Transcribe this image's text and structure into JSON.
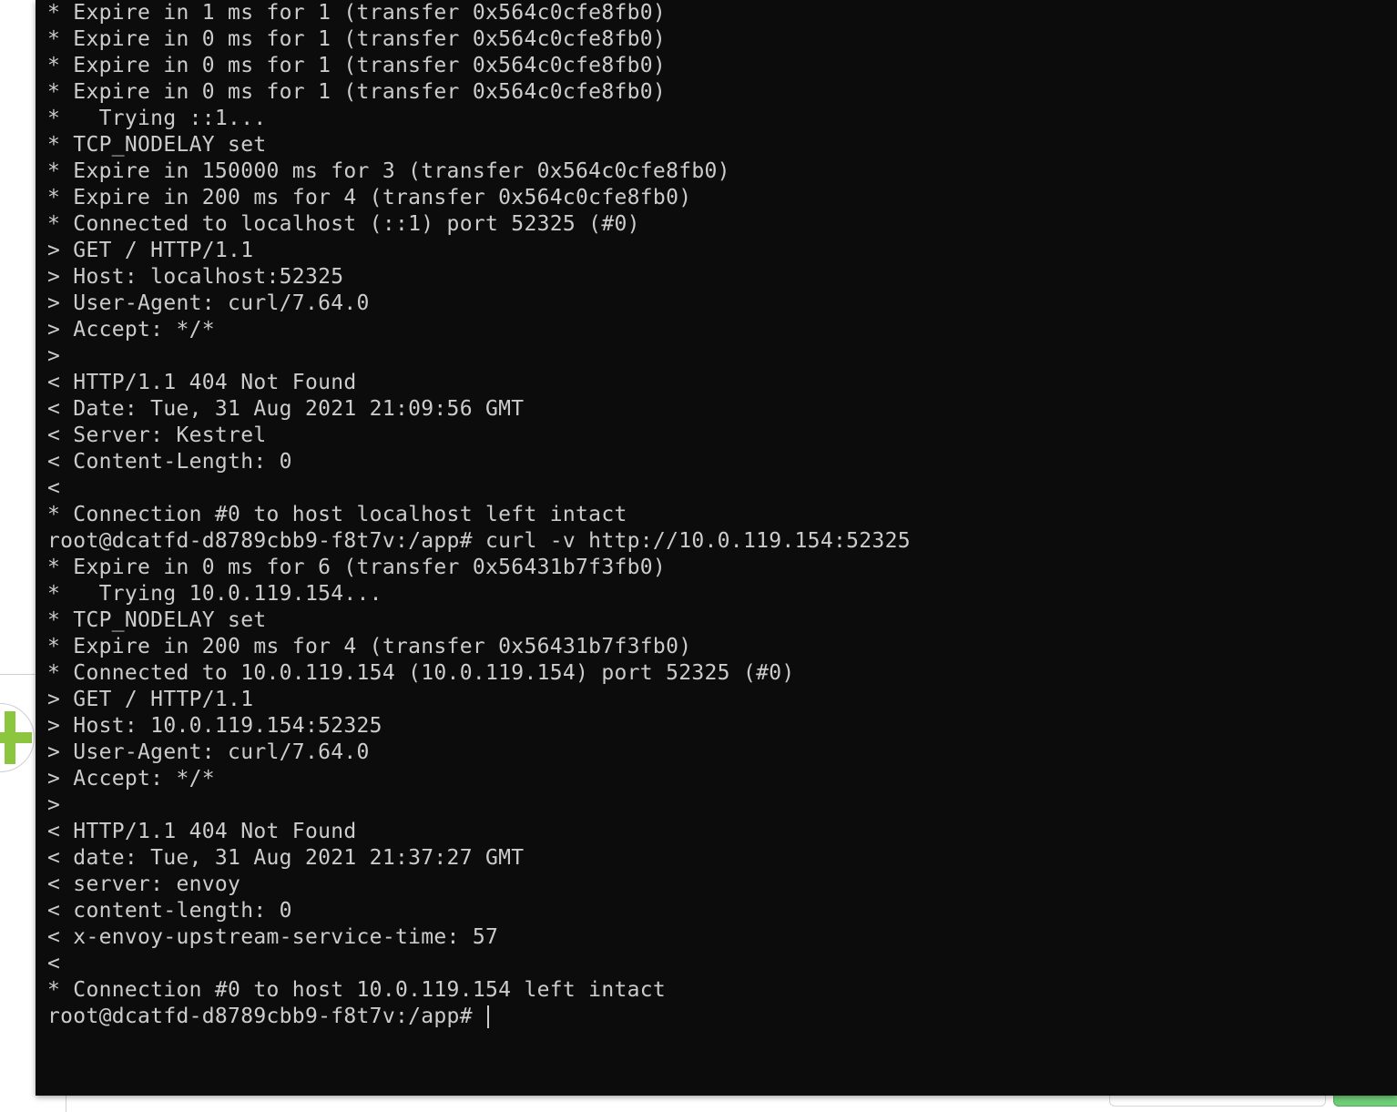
{
  "terminal": {
    "lines": [
      "* Expire in 1 ms for 1 (transfer 0x564c0cfe8fb0)",
      "* Expire in 0 ms for 1 (transfer 0x564c0cfe8fb0)",
      "* Expire in 0 ms for 1 (transfer 0x564c0cfe8fb0)",
      "* Expire in 0 ms for 1 (transfer 0x564c0cfe8fb0)",
      "*   Trying ::1...",
      "* TCP_NODELAY set",
      "* Expire in 150000 ms for 3 (transfer 0x564c0cfe8fb0)",
      "* Expire in 200 ms for 4 (transfer 0x564c0cfe8fb0)",
      "* Connected to localhost (::1) port 52325 (#0)",
      "> GET / HTTP/1.1",
      "> Host: localhost:52325",
      "> User-Agent: curl/7.64.0",
      "> Accept: */*",
      ">",
      "< HTTP/1.1 404 Not Found",
      "< Date: Tue, 31 Aug 2021 21:09:56 GMT",
      "< Server: Kestrel",
      "< Content-Length: 0",
      "<",
      "* Connection #0 to host localhost left intact",
      "root@dcatfd-d8789cbb9-f8t7v:/app# curl -v http://10.0.119.154:52325",
      "* Expire in 0 ms for 6 (transfer 0x56431b7f3fb0)",
      "*   Trying 10.0.119.154...",
      "* TCP_NODELAY set",
      "* Expire in 200 ms for 4 (transfer 0x56431b7f3fb0)",
      "* Connected to 10.0.119.154 (10.0.119.154) port 52325 (#0)",
      "> GET / HTTP/1.1",
      "> Host: 10.0.119.154:52325",
      "> User-Agent: curl/7.64.0",
      "> Accept: */*",
      ">",
      "< HTTP/1.1 404 Not Found",
      "< date: Tue, 31 Aug 2021 21:37:27 GMT",
      "< server: envoy",
      "< content-length: 0",
      "< x-envoy-upstream-service-time: 57",
      "<",
      "* Connection #0 to host 10.0.119.154 left intact"
    ],
    "prompt": "root@dcatfd-d8789cbb9-f8t7v:/app# "
  },
  "icons": {
    "add": "add-circle-icon"
  },
  "colors": {
    "terminal_background": "#0c0c0c",
    "terminal_text": "#cccccc",
    "accent_green": "#8cc63f"
  }
}
